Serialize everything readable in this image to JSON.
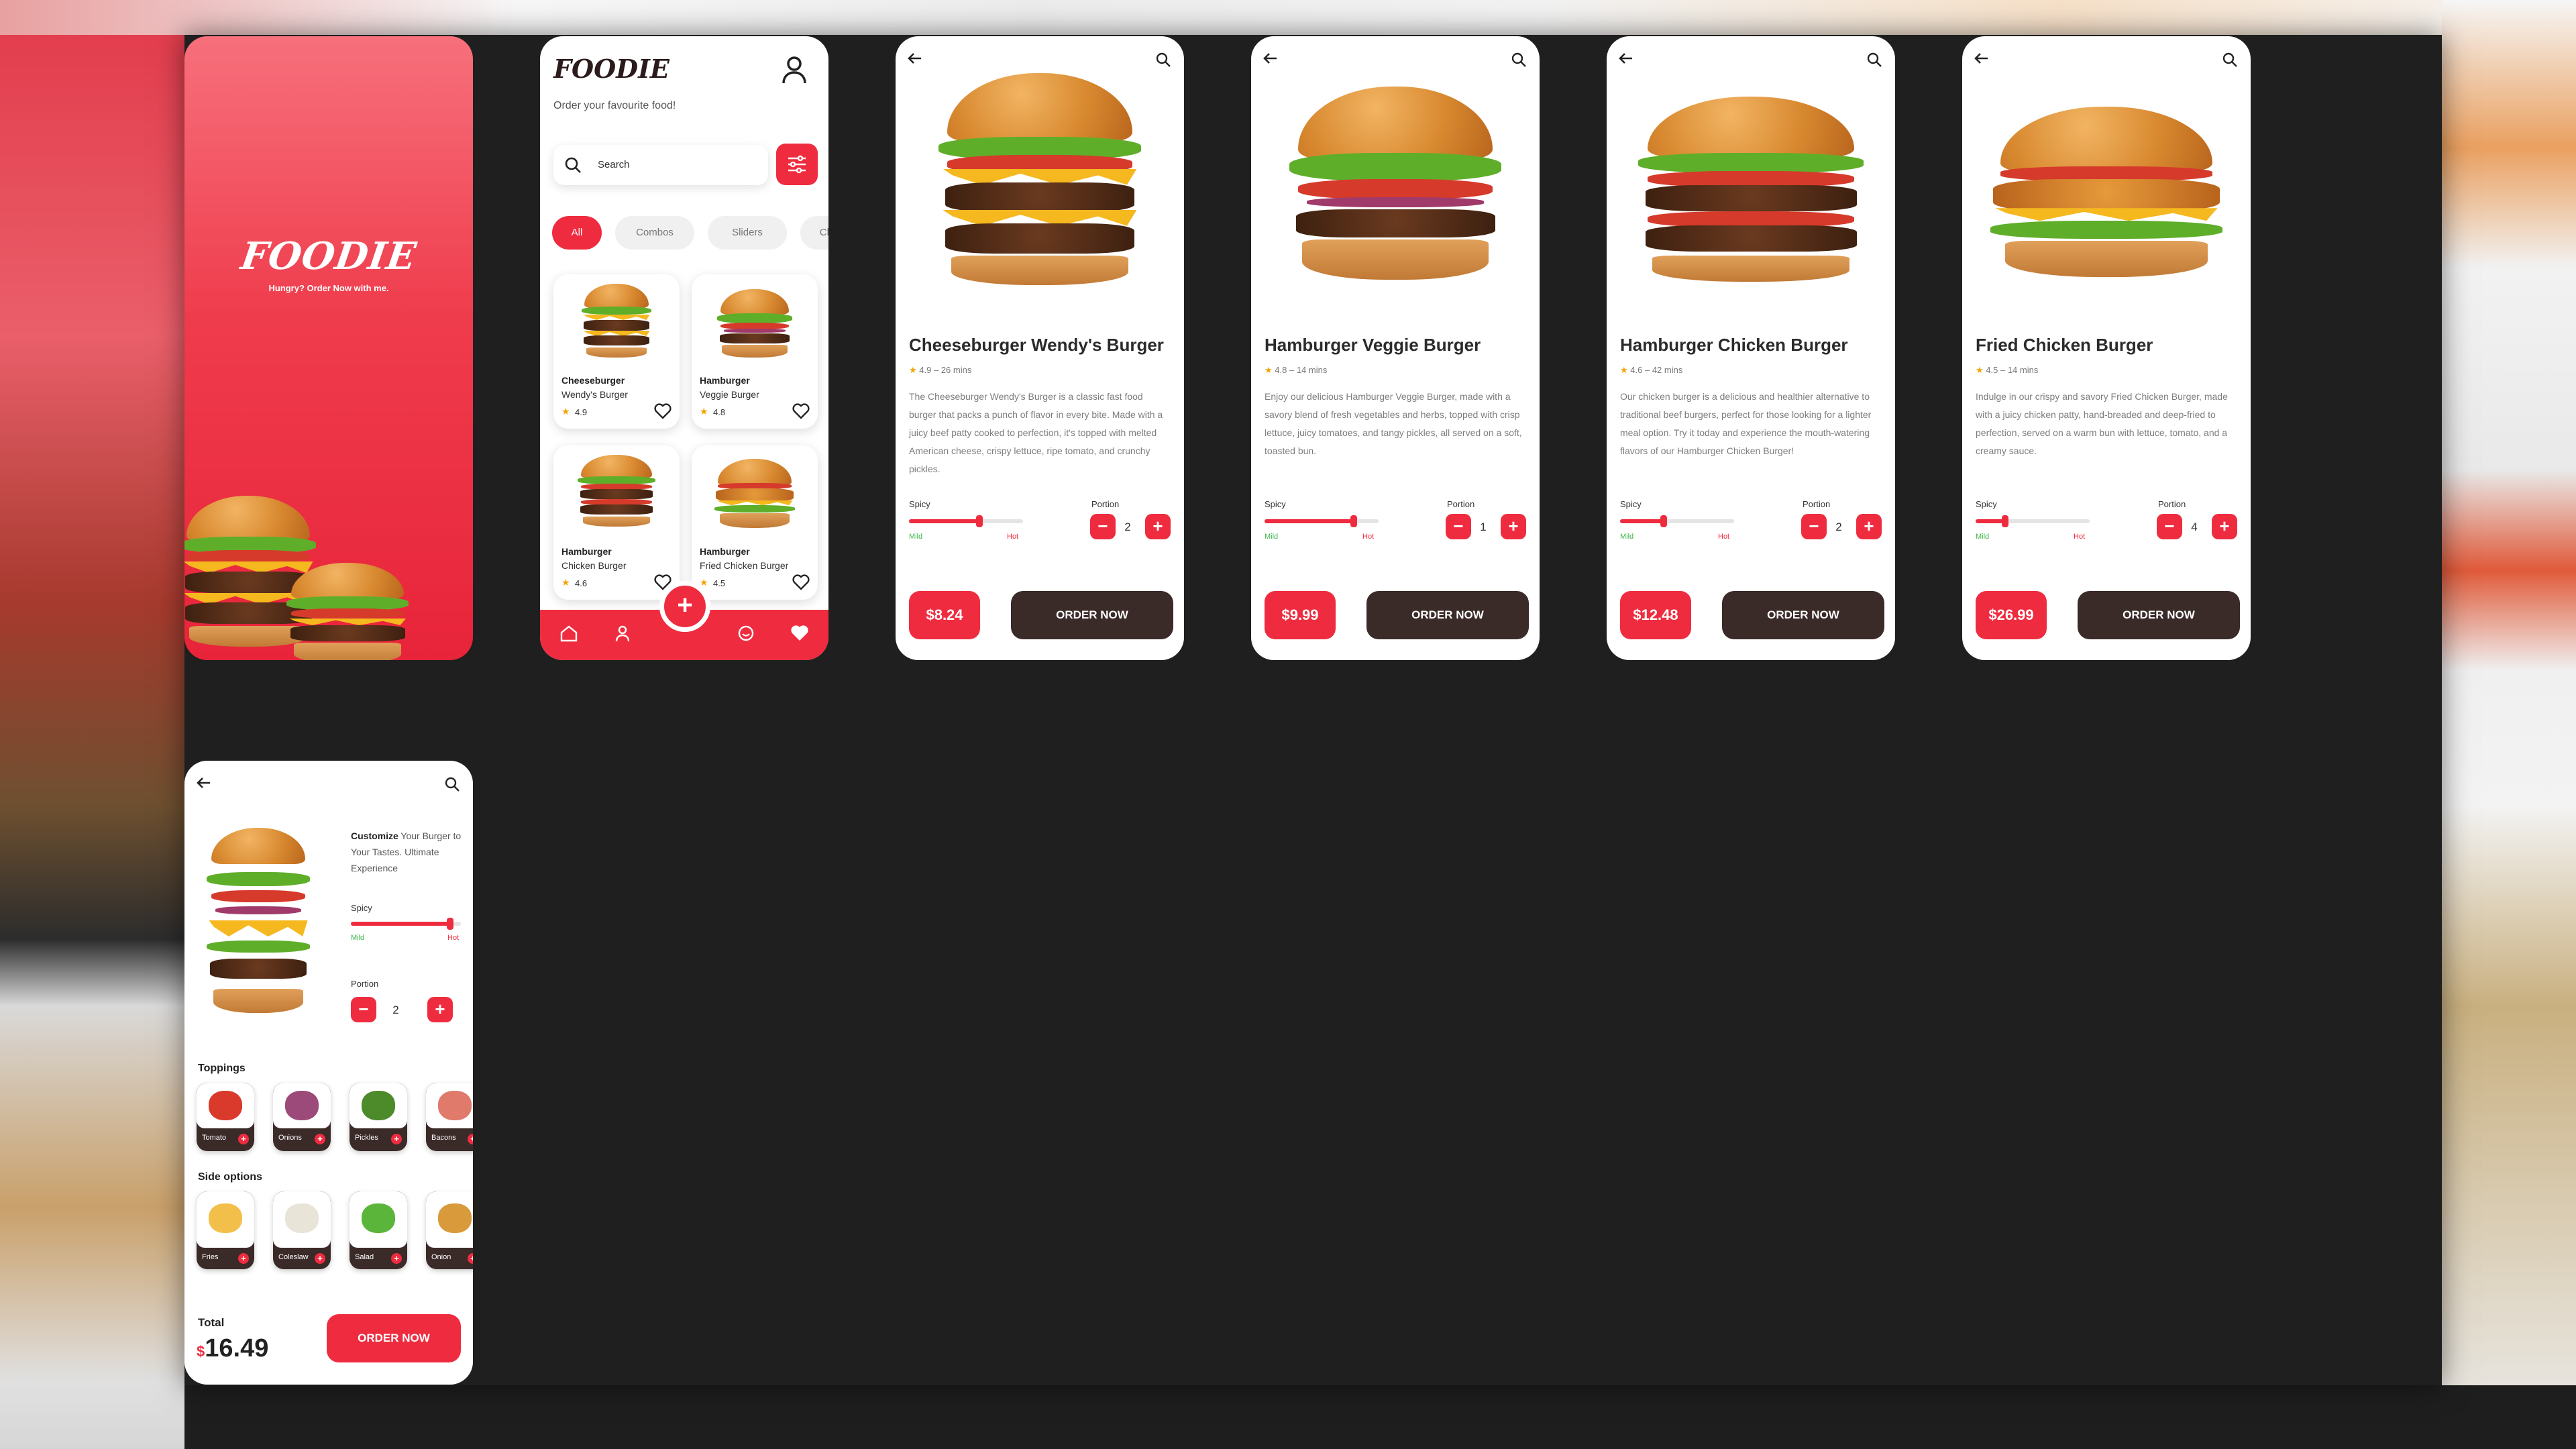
{
  "splash": {
    "logo": "FOODIE",
    "tagline": "Hungry? Order Now with me."
  },
  "home": {
    "logo": "FOODIE",
    "subtitle": "Order your favourite food!",
    "search_placeholder": "Search",
    "chips": [
      "All",
      "Combos",
      "Sliders",
      "Cla"
    ],
    "cards": [
      {
        "line1": "Cheeseburger",
        "line2": "Wendy's Burger",
        "rating": "4.9"
      },
      {
        "line1": "Hamburger",
        "line2": "Veggie Burger",
        "rating": "4.8"
      },
      {
        "line1": "Hamburger",
        "line2": "Chicken Burger",
        "rating": "4.6"
      },
      {
        "line1": "Hamburger",
        "line2": "Fried Chicken Burger",
        "rating": "4.5"
      }
    ],
    "fab": "+"
  },
  "details": [
    {
      "title": "Cheeseburger Wendy's Burger",
      "rating": "4.9",
      "time": "26 mins",
      "description": "The Cheeseburger Wendy's Burger is a classic fast food burger that packs a punch of flavor in every bite. Made with a juicy beef patty cooked to perfection, it's topped with melted American cheese, crispy lettuce, ripe tomato, and crunchy pickles.",
      "spicy_label": "Spicy",
      "portion_label": "Portion",
      "portion": "2",
      "spicy_level": 0.62,
      "mild": "Mild",
      "hot": "Hot",
      "price": "$8.24",
      "order": "ORDER NOW"
    },
    {
      "title": "Hamburger Veggie Burger",
      "rating": "4.8",
      "time": "14 mins",
      "description": "Enjoy our delicious Hamburger Veggie Burger, made with a savory blend of fresh vegetables and herbs, topped with crisp lettuce, juicy tomatoes, and tangy pickles, all served on a soft, toasted bun.",
      "spicy_label": "Spicy",
      "portion_label": "Portion",
      "portion": "1",
      "spicy_level": 0.78,
      "mild": "Mild",
      "hot": "Hot",
      "price": "$9.99",
      "order": "ORDER NOW"
    },
    {
      "title": "Hamburger Chicken Burger",
      "rating": "4.6",
      "time": "42 mins",
      "description": "Our chicken burger is a delicious and healthier alternative to traditional beef burgers, perfect for those looking for a lighter meal option. Try it today and experience the mouth-watering flavors of our Hamburger Chicken Burger!",
      "spicy_label": "Spicy",
      "portion_label": "Portion",
      "portion": "2",
      "spicy_level": 0.38,
      "mild": "Mild",
      "hot": "Hot",
      "price": "$12.48",
      "order": "ORDER NOW"
    },
    {
      "title": "Fried Chicken Burger",
      "rating": "4.5",
      "time": "14 mins",
      "description": "Indulge in our crispy and savory Fried Chicken Burger, made with a juicy chicken patty, hand-breaded and deep-fried to perfection, served on a warm bun with lettuce, tomato, and a creamy sauce.",
      "spicy_label": "Spicy",
      "portion_label": "Portion",
      "portion": "4",
      "spicy_level": 0.26,
      "mild": "Mild",
      "hot": "Hot",
      "price": "$26.99",
      "order": "ORDER NOW"
    }
  ],
  "customize": {
    "title_bold": "Customize",
    "title_rest": " Your Burger to Your Tastes. Ultimate Experience",
    "spicy_label": "Spicy",
    "mild": "Mild",
    "hot": "Hot",
    "spicy_level": 0.9,
    "portion_label": "Portion",
    "portion": "2",
    "toppings_label": "Toppings",
    "toppings": [
      "Tomato",
      "Onions",
      "Pickles",
      "Bacons"
    ],
    "sides_label": "Side options",
    "sides": [
      "Fries",
      "Coleslaw",
      "Salad",
      "Onion"
    ],
    "total_label": "Total",
    "total_currency": "$",
    "total_value": "16.49",
    "order": "ORDER NOW"
  },
  "colors": {
    "accent": "#ef2c3f",
    "dark": "#3a2a28",
    "star": "#f4a200",
    "mild": "#3bb54a"
  }
}
